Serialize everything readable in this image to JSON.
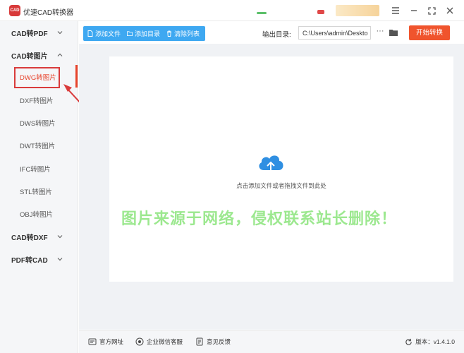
{
  "app": {
    "logo_text": "CAD",
    "title": "优速CAD转换器",
    "colors": {
      "accent_blue": "#3ea8f1",
      "accent_orange": "#f0542d",
      "active_red": "#e8432b",
      "watermark_green": "#9ce88f"
    }
  },
  "sidebar": {
    "groups": [
      {
        "label": "CAD转PDF",
        "state": "collapsed"
      },
      {
        "label": "CAD转图片",
        "state": "expanded",
        "items": [
          {
            "label": "DWG转图片",
            "active": true
          },
          {
            "label": "DXF转图片"
          },
          {
            "label": "DWS转图片"
          },
          {
            "label": "DWT转图片"
          },
          {
            "label": "IFC转图片"
          },
          {
            "label": "STL转图片"
          },
          {
            "label": "OBJ转图片"
          }
        ]
      },
      {
        "label": "CAD转DXF",
        "state": "collapsed"
      },
      {
        "label": "PDF转CAD",
        "state": "collapsed"
      }
    ]
  },
  "toolbar": {
    "add_file": "添加文件",
    "add_dir": "添加目录",
    "clear_list": "清除列表"
  },
  "output": {
    "label": "输出目录:",
    "path": "C:\\Users\\admin\\Deskto",
    "more": "···"
  },
  "start_button": "开始转换",
  "dropzone": {
    "hint": "点击添加文件或者拖拽文件到此处"
  },
  "watermark": "图片来源于网络，侵权联系站长删除！",
  "footer": {
    "website": "官方网址",
    "wechat": "企业微信客服",
    "feedback": "意见反馈",
    "version": "版本：v1.4.1.0"
  }
}
